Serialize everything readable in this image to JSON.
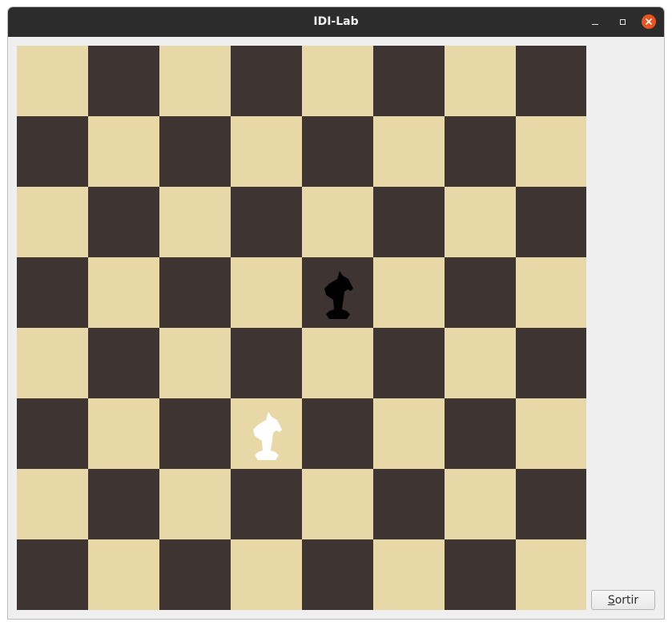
{
  "window": {
    "title": "IDI-Lab"
  },
  "board": {
    "size": 8,
    "light_color": "#e8d8a8",
    "dark_color": "#3e3532",
    "pieces": [
      {
        "type": "knight",
        "color": "black",
        "row": 3,
        "col": 4
      },
      {
        "type": "knight",
        "color": "white",
        "row": 5,
        "col": 3
      }
    ]
  },
  "actions": {
    "sortir_mnemonic": "S",
    "sortir_rest": "ortir"
  },
  "colors": {
    "titlebar": "#2c2c2c",
    "close_button": "#e95420",
    "window_bg": "#efefef"
  }
}
